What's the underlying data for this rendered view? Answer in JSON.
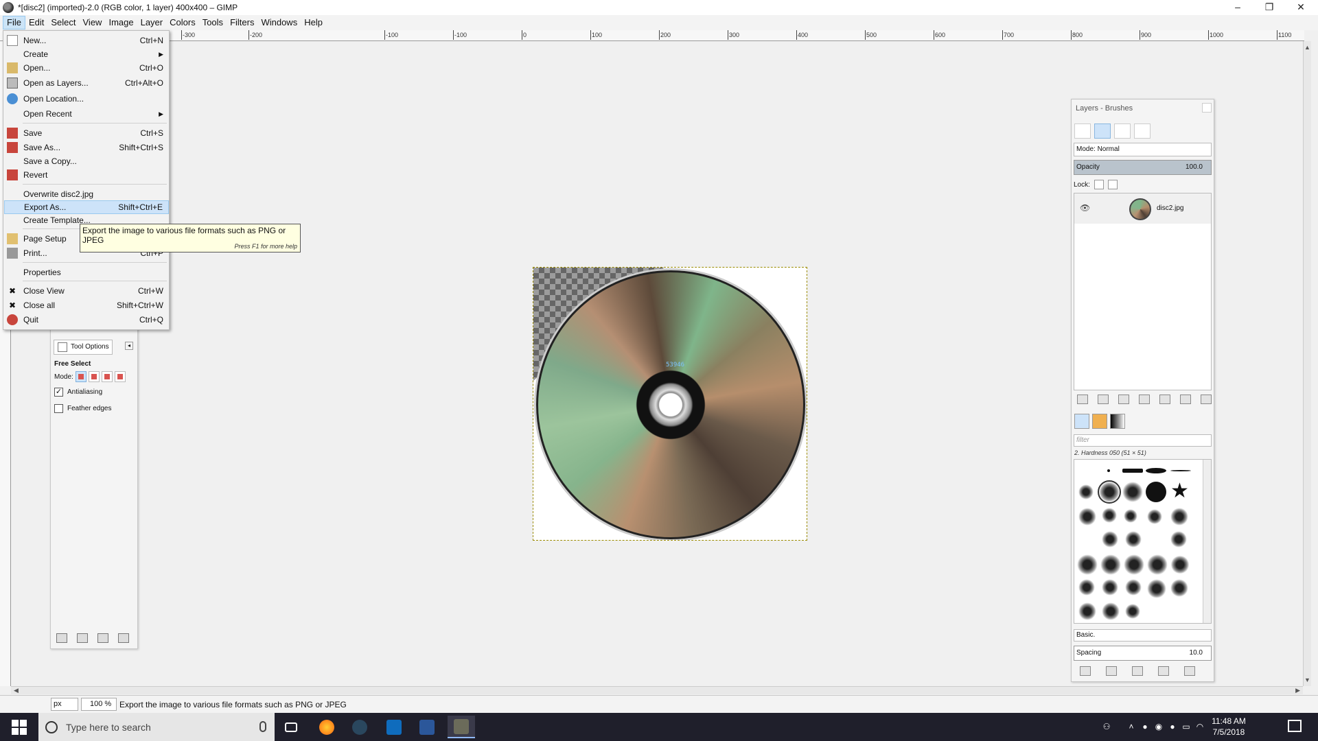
{
  "window": {
    "title": "*[disc2] (imported)-2.0 (RGB color, 1 layer) 400x400 – GIMP",
    "controls": [
      "–",
      "❐",
      "✕"
    ]
  },
  "menubar": [
    "File",
    "Edit",
    "Select",
    "View",
    "Image",
    "Layer",
    "Colors",
    "Tools",
    "Filters",
    "Windows",
    "Help"
  ],
  "ruler": {
    "labels": [
      "-300",
      "-200",
      "-100",
      "0",
      "100",
      "200",
      "300",
      "400",
      "500",
      "600",
      "700",
      "800",
      "900",
      "1000",
      "1100"
    ]
  },
  "file_menu": {
    "items": [
      {
        "label": "New...",
        "shortcut": "Ctrl+N",
        "icon": "new-document-icon"
      },
      {
        "label": "Create",
        "shortcut": "",
        "submenu": true
      },
      {
        "label": "Open...",
        "shortcut": "Ctrl+O",
        "icon": "folder-open-icon"
      },
      {
        "label": "Open as Layers...",
        "shortcut": "Ctrl+Alt+O",
        "icon": "layers-icon"
      },
      {
        "label": "Open Location...",
        "shortcut": "",
        "icon": "globe-icon"
      },
      {
        "label": "Open Recent",
        "shortcut": "",
        "submenu": true
      },
      {
        "label": "Save",
        "shortcut": "Ctrl+S",
        "icon": "save-icon"
      },
      {
        "label": "Save As...",
        "shortcut": "Shift+Ctrl+S",
        "icon": "save-as-icon"
      },
      {
        "label": "Save a Copy...",
        "shortcut": ""
      },
      {
        "label": "Revert",
        "shortcut": "",
        "icon": "revert-icon"
      },
      {
        "label": "Overwrite disc2.jpg",
        "shortcut": ""
      },
      {
        "label": "Export As...",
        "shortcut": "Shift+Ctrl+E",
        "highlighted": true
      },
      {
        "label": "Create Template...",
        "shortcut": ""
      },
      {
        "label": "Page Setup",
        "shortcut": "",
        "icon": "page-setup-icon"
      },
      {
        "label": "Print...",
        "shortcut": "Ctrl+P",
        "icon": "printer-icon"
      },
      {
        "label": "Properties",
        "shortcut": ""
      },
      {
        "label": "Close View",
        "shortcut": "Ctrl+W",
        "icon": "close-icon"
      },
      {
        "label": "Close all",
        "shortcut": "Shift+Ctrl+W",
        "icon": "close-all-icon"
      },
      {
        "label": "Quit",
        "shortcut": "Ctrl+Q",
        "icon": "quit-icon"
      }
    ]
  },
  "tooltip": {
    "text": "Export the image to various file formats such as PNG or JPEG",
    "help": "Press F1 for more help"
  },
  "tool_options": {
    "tab": "Tool Options",
    "tool": "Free Select",
    "mode_label": "Mode:",
    "antialiasing": "Antialiasing",
    "antialiasing_checked": true,
    "feather": "Feather edges",
    "feather_checked": false
  },
  "image": {
    "disc_label": "53946"
  },
  "statusbar": {
    "unit": "px",
    "zoom": "100 %",
    "message": "Export the image to various file formats such as PNG or JPEG"
  },
  "layers_dock": {
    "title": "Layers - Brushes",
    "mode": "Mode: Normal",
    "opacity_label": "Opacity",
    "opacity_value": "100.0",
    "lock_label": "Lock:",
    "layer_name": "disc2.jpg",
    "brush_filter_placeholder": "filter",
    "brush_name": "2. Hardness 050 (51 × 51)",
    "brush_preset": "Basic.",
    "spacing_label": "Spacing",
    "spacing_value": "10.0"
  },
  "taskbar": {
    "search_placeholder": "Type here to search",
    "time": "11:48 AM",
    "date": "7/5/2018"
  },
  "colors": {
    "menu_highlight": "#cde3f9",
    "tooltip_bg": "#ffffe1",
    "taskbar_bg": "#1f1f2b",
    "selection_dash": "#9a8a00"
  }
}
